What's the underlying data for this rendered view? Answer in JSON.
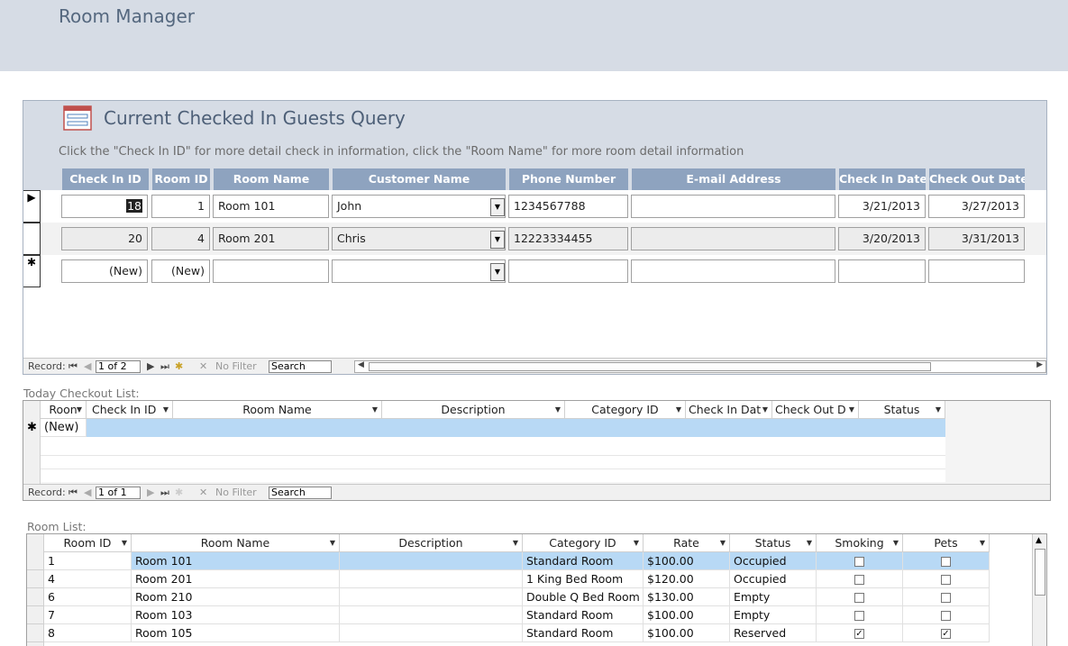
{
  "app": {
    "title": "Room Manager"
  },
  "form": {
    "title": "Current Checked In Guests Query",
    "hint": "Click the \"Check In ID\" for more detail check in information, click the \"Room Name\" for more room detail information",
    "columns": [
      "Check In ID",
      "Room ID",
      "Room Name",
      "Customer Name",
      "Phone Number",
      "E-mail Address",
      "Check In Date",
      "Check Out Date"
    ],
    "rows": [
      {
        "check_in_id": "18",
        "room_id": "1",
        "room_name": "Room 101",
        "customer": "John",
        "phone": "1234567788",
        "email": "",
        "check_in": "3/21/2013",
        "check_out": "3/27/2013"
      },
      {
        "check_in_id": "20",
        "room_id": "4",
        "room_name": "Room 201",
        "customer": "Chris",
        "phone": "12223334455",
        "email": "",
        "check_in": "3/20/2013",
        "check_out": "3/31/2013"
      }
    ],
    "new_row": {
      "check_in_id": "(New)",
      "room_id": "(New)"
    },
    "nav": {
      "record_label": "Record:",
      "position": "1 of 2",
      "filter": "No Filter",
      "search": "Search"
    }
  },
  "checkout": {
    "label": "Today Checkout List:",
    "columns": [
      "Roon",
      "Check In ID",
      "Room Name",
      "Description",
      "Category ID",
      "Check In Dat",
      "Check Out D",
      "Status"
    ],
    "new_row": "(New)",
    "nav": {
      "record_label": "Record:",
      "position": "1 of 1",
      "filter": "No Filter",
      "search": "Search"
    }
  },
  "rooms": {
    "label": "Room List:",
    "columns": [
      "Room ID",
      "Room Name",
      "Description",
      "Category ID",
      "Rate",
      "Status",
      "Smoking",
      "Pets"
    ],
    "rows": [
      {
        "id": "1",
        "name": "Room 101",
        "desc": "",
        "category": "Standard Room",
        "rate": "$100.00",
        "status": "Occupied",
        "smoking": false,
        "pets": false
      },
      {
        "id": "4",
        "name": "Room 201",
        "desc": "",
        "category": "1 King Bed Room",
        "rate": "$120.00",
        "status": "Occupied",
        "smoking": false,
        "pets": false
      },
      {
        "id": "6",
        "name": "Room 210",
        "desc": "",
        "category": "Double Q Bed Room",
        "rate": "$130.00",
        "status": "Empty",
        "smoking": false,
        "pets": false
      },
      {
        "id": "7",
        "name": "Room 103",
        "desc": "",
        "category": "Standard Room",
        "rate": "$100.00",
        "status": "Empty",
        "smoking": false,
        "pets": false
      },
      {
        "id": "8",
        "name": "Room 105",
        "desc": "",
        "category": "Standard Room",
        "rate": "$100.00",
        "status": "Reserved",
        "smoking": true,
        "pets": true
      }
    ]
  },
  "colors": {
    "header_bg": "#d6dce5",
    "column_head": "#8ea3bf",
    "selected_row": "#b8d9f5"
  }
}
